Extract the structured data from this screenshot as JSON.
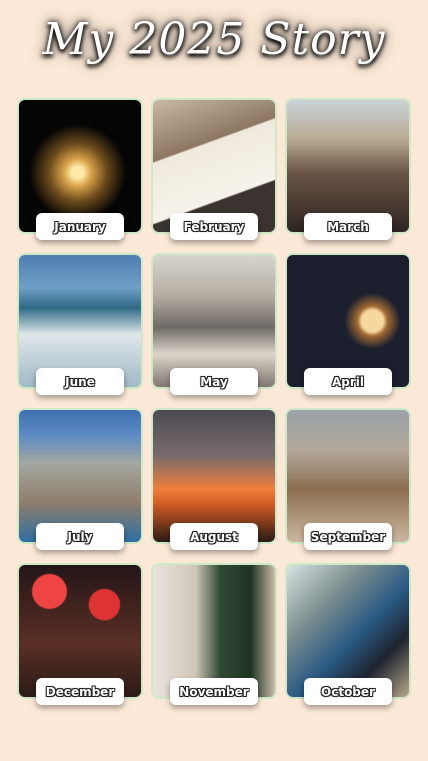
{
  "title": "My 2025 Story",
  "tiles": [
    {
      "label": "January"
    },
    {
      "label": "February"
    },
    {
      "label": "March"
    },
    {
      "label": "June"
    },
    {
      "label": "May"
    },
    {
      "label": "April"
    },
    {
      "label": "July"
    },
    {
      "label": "August"
    },
    {
      "label": "September"
    },
    {
      "label": "December"
    },
    {
      "label": "November"
    },
    {
      "label": "October"
    }
  ],
  "colors": {
    "background": "#fbe8d6",
    "tile_border": "#cfe8c6",
    "label_bg": "#ffffff"
  }
}
